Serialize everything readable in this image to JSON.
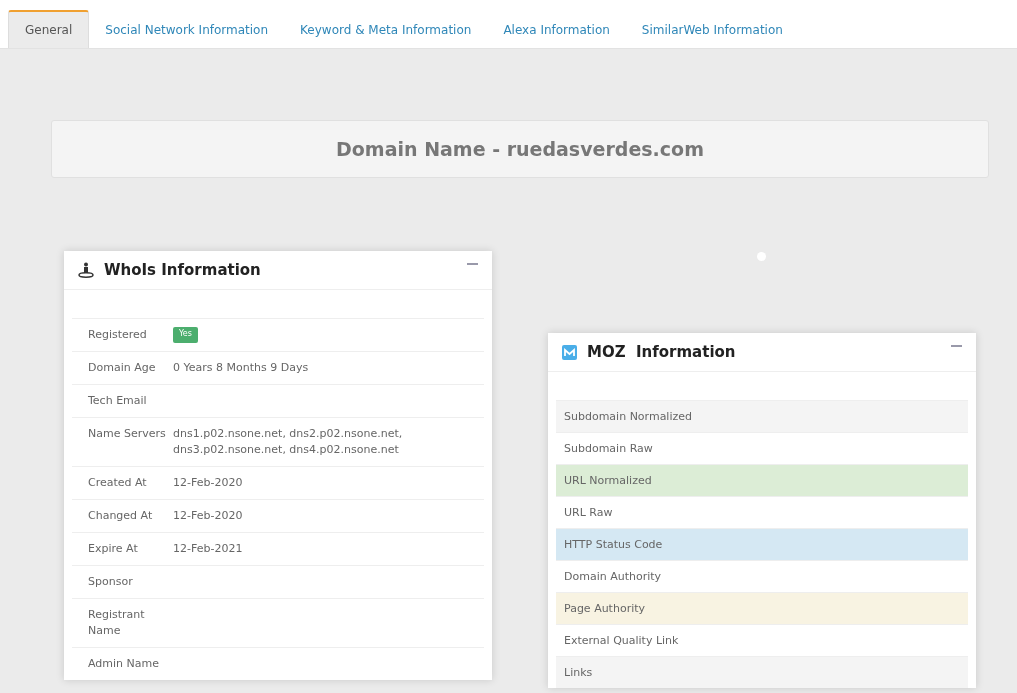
{
  "tabs": [
    {
      "label": "General",
      "selected": true
    },
    {
      "label": "Social Network Information",
      "selected": false
    },
    {
      "label": "Keyword & Meta Information",
      "selected": false
    },
    {
      "label": "Alexa Information",
      "selected": false
    },
    {
      "label": "SimilarWeb Information",
      "selected": false
    }
  ],
  "domain_heading": "Domain Name - ruedasverdes.com",
  "whois": {
    "title": "WhoIs Information",
    "rows": [
      {
        "label": "Registered",
        "badge": "Yes"
      },
      {
        "label": "Domain Age",
        "value": "0 Years 8 Months 9 Days"
      },
      {
        "label": "Tech Email"
      },
      {
        "label": "Name Servers",
        "value": "dns1.p02.nsone.net, dns2.p02.nsone.net, dns3.p02.nsone.net, dns4.p02.nsone.net"
      },
      {
        "label": "Created At",
        "value": "12-Feb-2020"
      },
      {
        "label": "Changed At",
        "value": "12-Feb-2020"
      },
      {
        "label": "Expire At",
        "value": "12-Feb-2021"
      },
      {
        "label": "Sponsor"
      },
      {
        "label": "Registrant Name"
      },
      {
        "label": "Admin Name"
      }
    ]
  },
  "moz": {
    "title": "MOZ  Information",
    "rows": [
      {
        "label": "Subdomain Normalized",
        "kind": "shaded"
      },
      {
        "label": "Subdomain Raw",
        "kind": "plain"
      },
      {
        "label": "URL Normalized",
        "kind": "success"
      },
      {
        "label": "URL Raw",
        "kind": "plain"
      },
      {
        "label": "HTTP Status Code",
        "kind": "info"
      },
      {
        "label": "Domain Authority",
        "kind": "plain"
      },
      {
        "label": "Page Authority",
        "kind": "warning"
      },
      {
        "label": "External Quality Link",
        "kind": "plain"
      },
      {
        "label": "Links",
        "kind": "shaded"
      }
    ]
  }
}
